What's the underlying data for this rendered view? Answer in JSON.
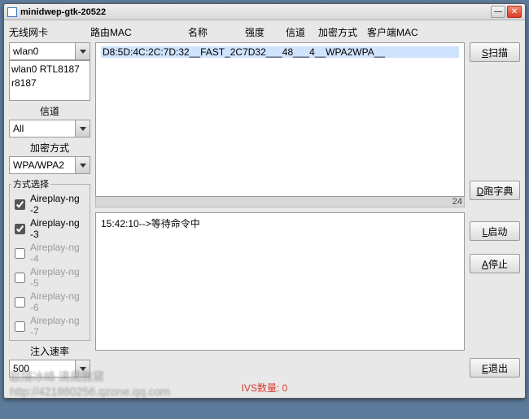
{
  "window": {
    "title": "minidwep-gtk-20522"
  },
  "headers": {
    "wlancard": "无线网卡",
    "routermac": "路由MAC",
    "name": "名称",
    "strength": "强度",
    "channel": "信道",
    "enc": "加密方式",
    "clientmac": "客户端MAC"
  },
  "wlan": {
    "selected": "wlan0",
    "detail": "wlan0 RTL8187\nr8187"
  },
  "channel": {
    "label": "信道",
    "selected": "All"
  },
  "encmode": {
    "label": "加密方式",
    "selected": "WPA/WPA2"
  },
  "methods": {
    "legend": "方式选择",
    "items": [
      {
        "label": "Aireplay-ng -2",
        "checked": true
      },
      {
        "label": "Aireplay-ng -3",
        "checked": true
      },
      {
        "label": "Aireplay-ng -4",
        "checked": false
      },
      {
        "label": "Aireplay-ng -5",
        "checked": false
      },
      {
        "label": "Aireplay-ng -6",
        "checked": false
      },
      {
        "label": "Aireplay-ng -7",
        "checked": false
      }
    ]
  },
  "injrate": {
    "label": "注入速率",
    "selected": "500"
  },
  "scan": {
    "row": "D8:5D:4C:2C:7D:32__FAST_2C7D32___48___4__WPA2WPA__",
    "scroll": "24"
  },
  "log": {
    "line": "15:42:10-->等待命令中"
  },
  "buttons": {
    "scan": {
      "u": "S",
      "t": "扫描"
    },
    "dict": {
      "u": "D",
      "t": "跑字典"
    },
    "start": {
      "u": "L",
      "t": "启动"
    },
    "stop": {
      "u": "A",
      "t": "停止"
    },
    "exit": {
      "u": "E",
      "t": "退出"
    }
  },
  "footer": {
    "ivs": "IVS数量: 0"
  },
  "watermark": "歐陽冰峰 清風雅黛\nhttp://421860256.qzone.qq.com"
}
